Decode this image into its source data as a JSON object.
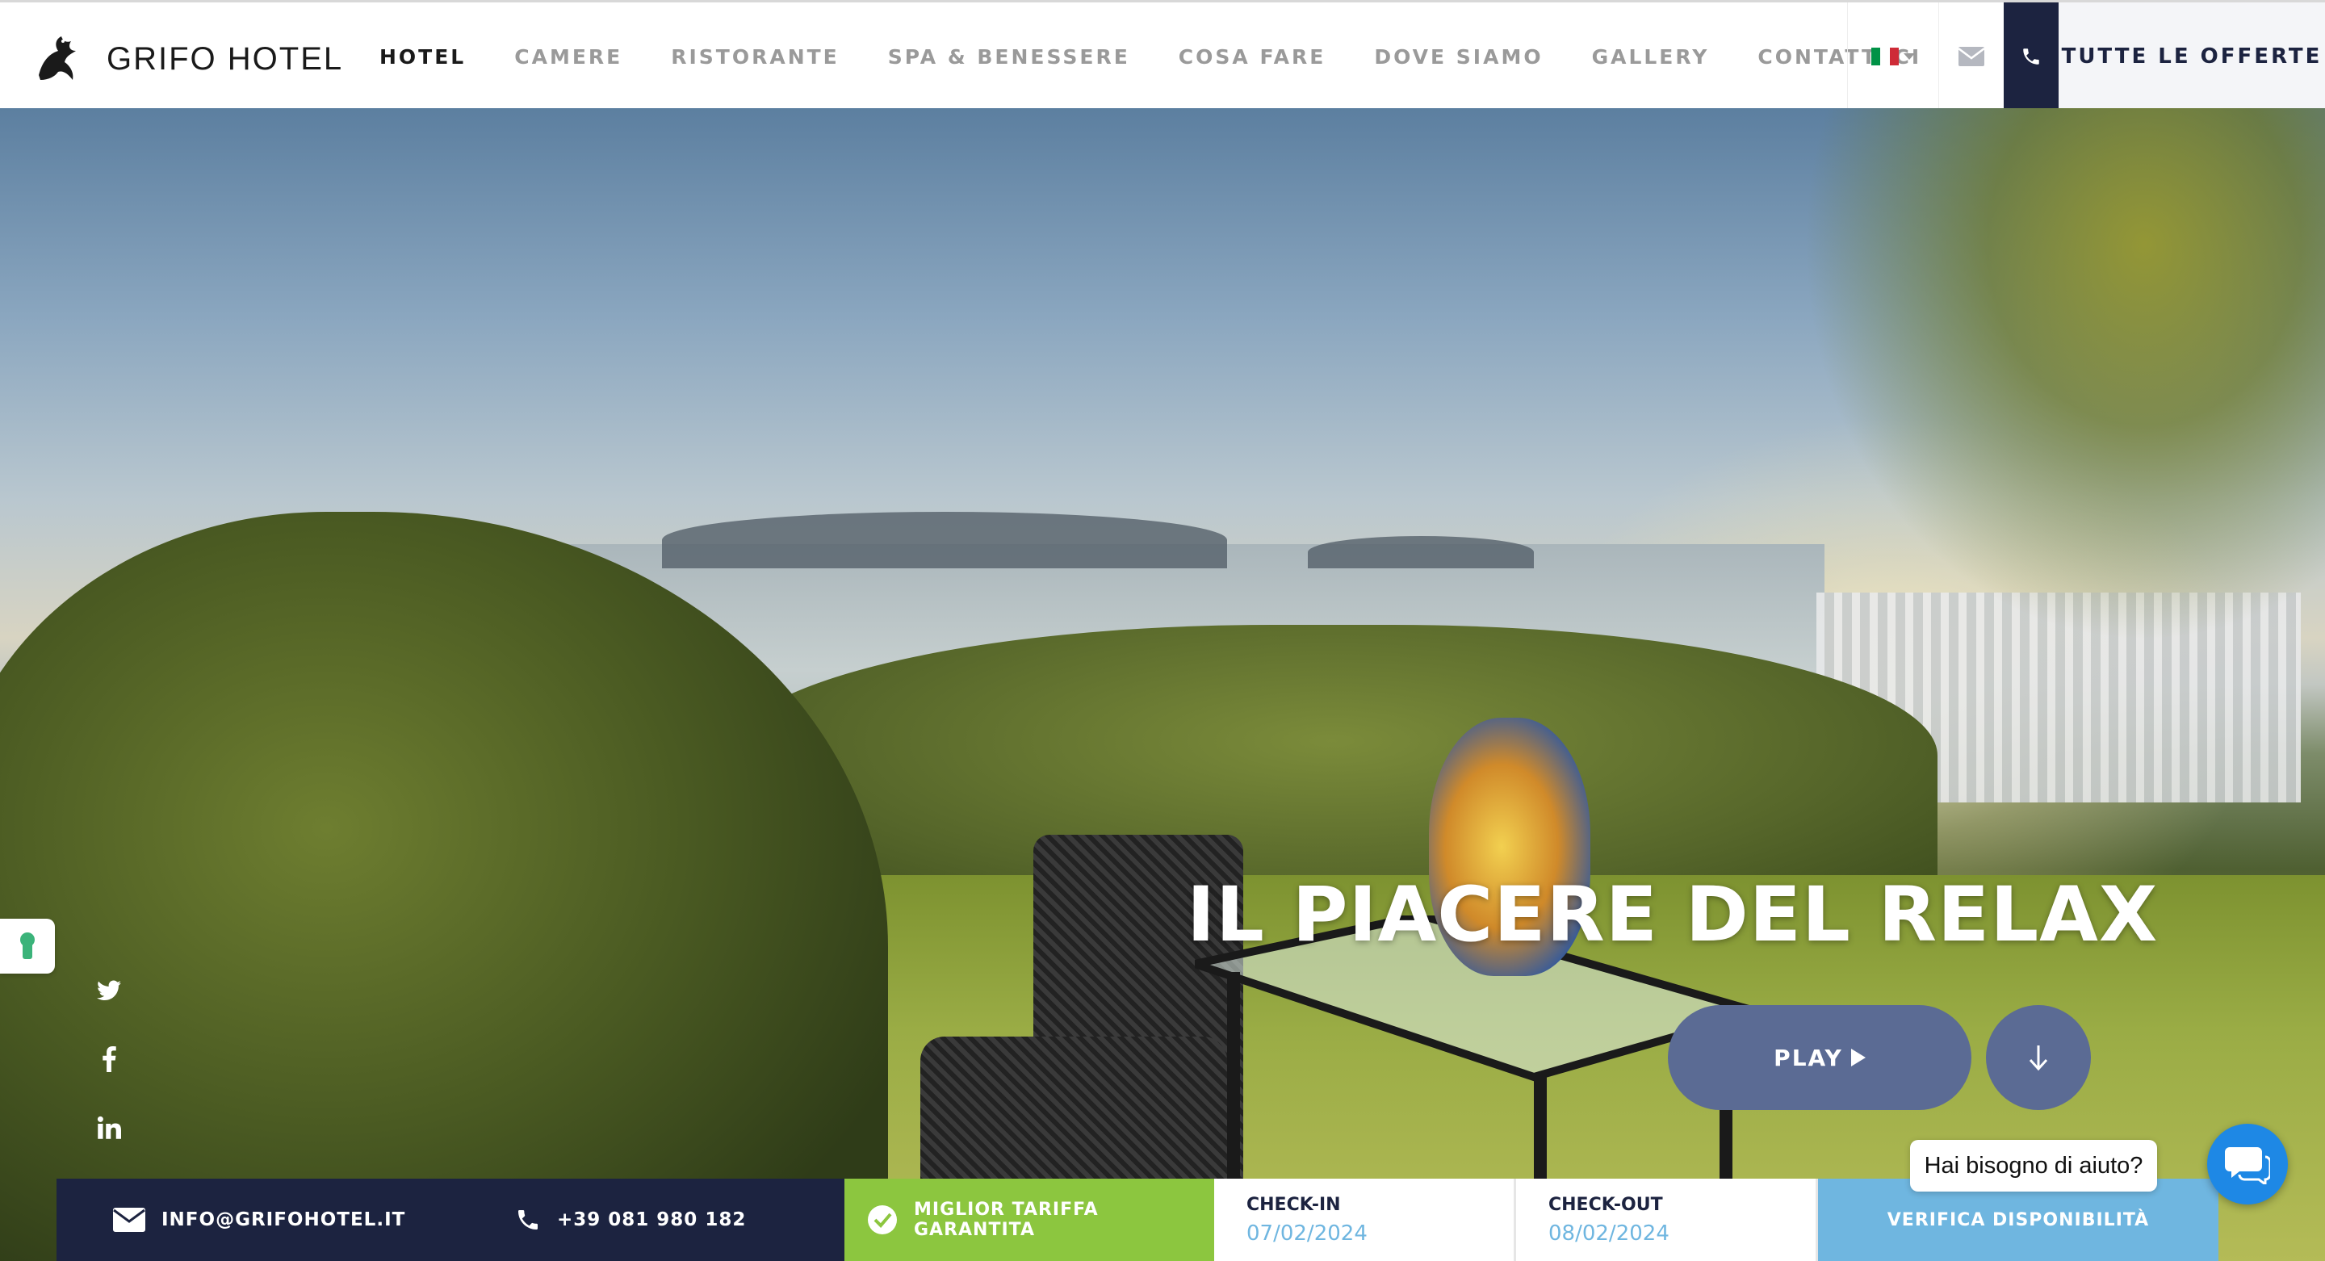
{
  "header": {
    "brand": "GRIFO HOTEL",
    "nav": [
      {
        "label": "HOTEL",
        "active": true
      },
      {
        "label": "CAMERE"
      },
      {
        "label": "RISTORANTE"
      },
      {
        "label": "SPA & BENESSERE"
      },
      {
        "label": "COSA FARE"
      },
      {
        "label": "DOVE SIAMO"
      },
      {
        "label": "GALLERY"
      },
      {
        "label": "CONTATTACI"
      }
    ],
    "language_flag": "italy-flag-icon",
    "offers_label": "TUTTE LE OFFERTE"
  },
  "hero": {
    "headline": "IL PIACERE DEL RELAX",
    "play_label": "PLAY"
  },
  "social": [
    "twitter-icon",
    "facebook-icon",
    "linkedin-icon"
  ],
  "booking_bar": {
    "email": "INFO@GRIFOHOTEL.IT",
    "phone": "+39 081 980 182",
    "best_rate": "MIGLIOR TARIFFA GARANTITA",
    "checkin_label": "CHECK-IN",
    "checkin_value": "07/02/2024",
    "checkout_label": "CHECK-OUT",
    "checkout_value": "08/02/2024",
    "verify_label": "VERIFICA DISPONIBILITÀ"
  },
  "help": {
    "bubble_text": "Hai bisogno di aiuto?"
  },
  "colors": {
    "navy": "#1c2340",
    "green": "#8cc63f",
    "light_blue": "#6fb6e0",
    "slate_button": "#5b6b94",
    "chat_blue": "#1e88e5"
  }
}
